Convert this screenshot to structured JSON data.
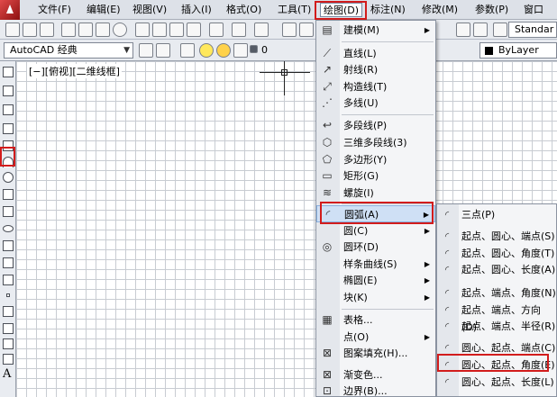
{
  "menubar": {
    "items": [
      "文件(F)",
      "编辑(E)",
      "视图(V)",
      "插入(I)",
      "格式(O)",
      "工具(T)",
      "绘图(D)",
      "标注(N)",
      "修改(M)",
      "参数(P)",
      "窗口"
    ]
  },
  "toolbar": {
    "workspace": "AutoCAD 经典",
    "layer": "0",
    "standard": "Standar",
    "bylayer": "ByLayer"
  },
  "canvas": {
    "viewport_label": "[−][俯视][二维线框]"
  },
  "draw_menu": {
    "items": [
      {
        "label": "建模(M)",
        "icon": "modeling-icon",
        "submenu": "▶"
      },
      {
        "label": "直线(L)",
        "icon": "line-icon"
      },
      {
        "label": "射线(R)",
        "icon": "ray-icon"
      },
      {
        "label": "构造线(T)",
        "icon": "xline-icon"
      },
      {
        "label": "多线(U)",
        "icon": "multiline-icon"
      },
      {
        "label": "多段线(P)",
        "icon": "polyline-icon"
      },
      {
        "label": "三维多段线(3)",
        "icon": "3d-polyline-icon"
      },
      {
        "label": "多边形(Y)",
        "icon": "polygon-icon"
      },
      {
        "label": "矩形(G)",
        "icon": "rectangle-icon"
      },
      {
        "label": "螺旋(I)",
        "icon": "helix-icon"
      },
      {
        "label": "圆弧(A)",
        "icon": "arc-icon",
        "submenu": "▶"
      },
      {
        "label": "圆(C)",
        "icon": "circle-icon",
        "submenu": "▶"
      },
      {
        "label": "圆环(D)",
        "icon": "donut-icon"
      },
      {
        "label": "样条曲线(S)",
        "icon": "spline-icon",
        "submenu": "▶"
      },
      {
        "label": "椭圆(E)",
        "icon": "ellipse-icon",
        "submenu": "▶"
      },
      {
        "label": "块(K)",
        "icon": "block-icon",
        "submenu": "▶"
      },
      {
        "label": "表格...",
        "icon": "table-icon"
      },
      {
        "label": "点(O)",
        "icon": "point-icon",
        "submenu": "▶"
      },
      {
        "label": "图案填充(H)...",
        "icon": "hatch-icon"
      },
      {
        "label": "渐变色...",
        "icon": "gradient-icon"
      },
      {
        "label": "边界(B)...",
        "icon": "boundary-icon"
      }
    ]
  },
  "arc_submenu": {
    "items": [
      {
        "label": "三点(P)",
        "icon": "arc-3point-icon"
      },
      {
        "label": "起点、圆心、端点(S)",
        "icon": "arc-sce-icon"
      },
      {
        "label": "起点、圆心、角度(T)",
        "icon": "arc-sca-icon"
      },
      {
        "label": "起点、圆心、长度(A)",
        "icon": "arc-scl-icon"
      },
      {
        "label": "起点、端点、角度(N)",
        "icon": "arc-sea-icon"
      },
      {
        "label": "起点、端点、方向(D)",
        "icon": "arc-sed-icon"
      },
      {
        "label": "起点、端点、半径(R)",
        "icon": "arc-ser-icon"
      },
      {
        "label": "圆心、起点、端点(C)",
        "icon": "arc-cse-icon"
      },
      {
        "label": "圆心、起点、角度(E)",
        "icon": "arc-csa-icon"
      },
      {
        "label": "圆心、起点、长度(L)",
        "icon": "arc-csl-icon"
      }
    ]
  },
  "colors": {
    "highlight": "#d21c1c",
    "menu_bg": "#f4f5f7",
    "hover": "#cfe0f5"
  }
}
